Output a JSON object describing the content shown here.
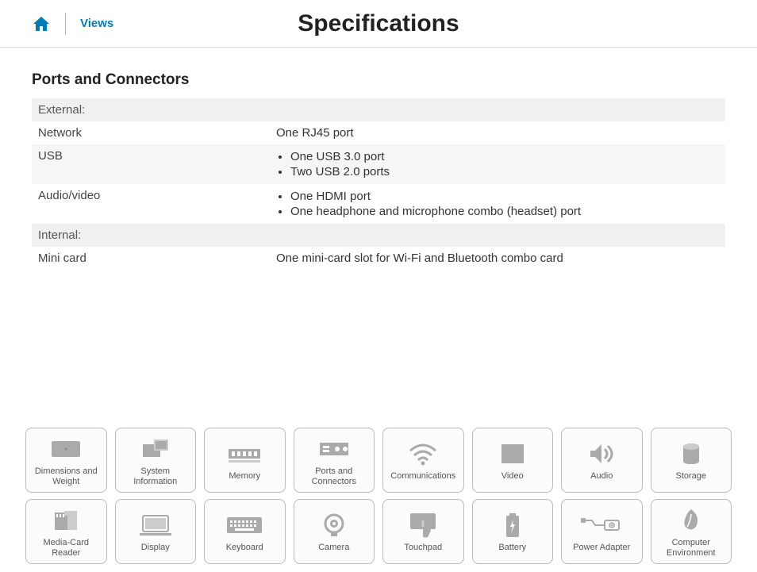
{
  "header": {
    "views_label": "Views",
    "title": "Specifications"
  },
  "section": {
    "title": "Ports and Connectors",
    "groups": [
      {
        "header": "External:",
        "rows": [
          {
            "label": "Network",
            "value": "One RJ45 port",
            "list": null,
            "alt": false
          },
          {
            "label": "USB",
            "value": null,
            "list": [
              "One USB 3.0 port",
              "Two USB 2.0 ports"
            ],
            "alt": true
          },
          {
            "label": "Audio/video",
            "value": null,
            "list": [
              "One HDMI port",
              "One headphone and microphone combo (headset) port"
            ],
            "alt": false
          }
        ]
      },
      {
        "header": "Internal:",
        "rows": [
          {
            "label": "Mini card",
            "value": "One mini-card slot for Wi-Fi and Bluetooth combo card",
            "list": null,
            "alt": false
          }
        ]
      }
    ]
  },
  "nav": {
    "rows": [
      [
        {
          "id": "dimensions",
          "label": "Dimensions and Weight"
        },
        {
          "id": "system-info",
          "label": "System Information"
        },
        {
          "id": "memory",
          "label": "Memory"
        },
        {
          "id": "ports",
          "label": "Ports and Connectors"
        },
        {
          "id": "communications",
          "label": "Communications"
        },
        {
          "id": "video",
          "label": "Video"
        },
        {
          "id": "audio",
          "label": "Audio"
        },
        {
          "id": "storage",
          "label": "Storage"
        }
      ],
      [
        {
          "id": "media-card",
          "label": "Media-Card Reader"
        },
        {
          "id": "display",
          "label": "Display"
        },
        {
          "id": "keyboard",
          "label": "Keyboard"
        },
        {
          "id": "camera",
          "label": "Camera"
        },
        {
          "id": "touchpad",
          "label": "Touchpad"
        },
        {
          "id": "battery",
          "label": "Battery"
        },
        {
          "id": "power-adapter",
          "label": "Power Adapter"
        },
        {
          "id": "environment",
          "label": "Computer Environment"
        }
      ]
    ]
  }
}
